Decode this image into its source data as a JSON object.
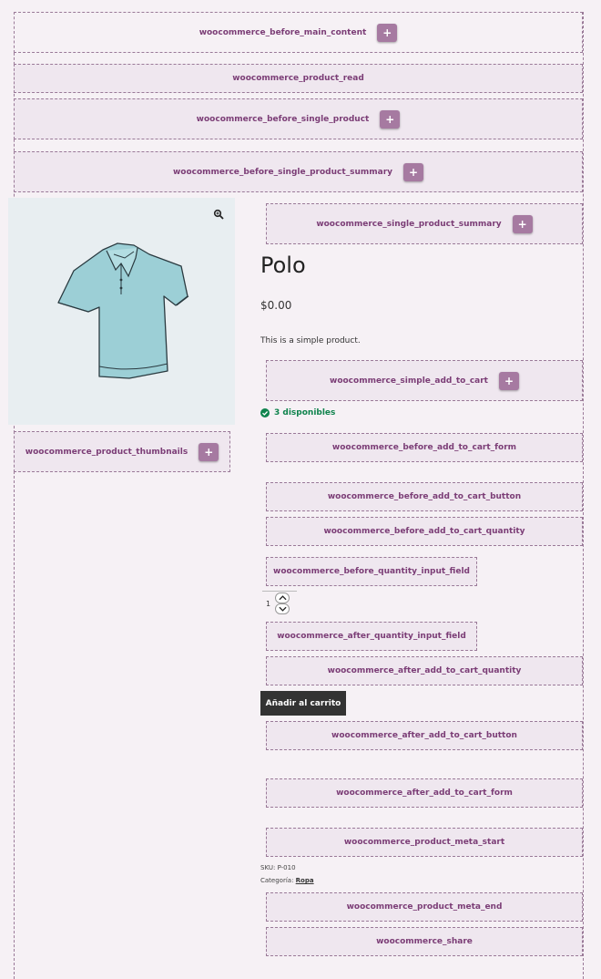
{
  "hooks": {
    "before_main_content": "woocommerce_before_main_content",
    "product_read": "woocommerce_product_read",
    "before_single_product": "woocommerce_before_single_product",
    "before_single_product_summary": "woocommerce_before_single_product_summary",
    "single_product_summary": "woocommerce_single_product_summary",
    "simple_add_to_cart": "woocommerce_simple_add_to_cart",
    "product_thumbnails": "woocommerce_product_thumbnails",
    "before_add_to_cart_form": "woocommerce_before_add_to_cart_form",
    "before_add_to_cart_button": "woocommerce_before_add_to_cart_button",
    "before_add_to_cart_quantity": "woocommerce_before_add_to_cart_quantity",
    "before_quantity_input_field": "woocommerce_before_quantity_input_field",
    "after_quantity_input_field": "woocommerce_after_quantity_input_field",
    "after_add_to_cart_quantity": "woocommerce_after_add_to_cart_quantity",
    "after_add_to_cart_button": "woocommerce_after_add_to_cart_button",
    "after_add_to_cart_form": "woocommerce_after_add_to_cart_form",
    "product_meta_start": "woocommerce_product_meta_start",
    "product_meta_end": "woocommerce_product_meta_end",
    "share": "woocommerce_share",
    "add_symbol": "+"
  },
  "product": {
    "title": "Polo",
    "price": "$0.00",
    "description": "This is a simple product.",
    "stock": "3 disponibles",
    "quantity": "1",
    "add_to_cart_label": "Añadir al carrito",
    "sku_label": "SKU:",
    "sku_value": "P-010",
    "category_label": "Categoría:",
    "category_value": "Ropa",
    "image_alt": "polo-shirt-image"
  },
  "colors": {
    "hook_text": "#7b3d76",
    "add_button": "#a67aa1",
    "cart_button": "#333333",
    "stock": "#0f834d",
    "background": "#f6f1f5"
  }
}
